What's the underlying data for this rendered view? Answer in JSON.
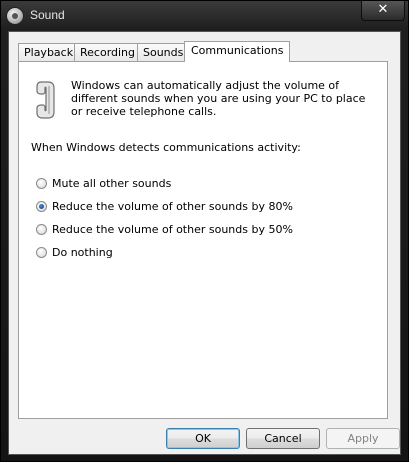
{
  "window": {
    "title": "Sound",
    "close_label": "✕"
  },
  "tabs": [
    {
      "label": "Playback"
    },
    {
      "label": "Recording"
    },
    {
      "label": "Sounds"
    },
    {
      "label": "Communications",
      "active": true
    }
  ],
  "communications": {
    "description": "Windows can automatically adjust the volume of different sounds when you are using your PC to place or receive telephone calls.",
    "prompt": "When Windows detects communications activity:",
    "options": [
      {
        "label": "Mute all other sounds",
        "checked": false
      },
      {
        "label": "Reduce the volume of other sounds by 80%",
        "checked": true
      },
      {
        "label": "Reduce the volume of other sounds by 50%",
        "checked": false
      },
      {
        "label": "Do nothing",
        "checked": false
      }
    ]
  },
  "buttons": {
    "ok": "OK",
    "cancel": "Cancel",
    "apply": "Apply"
  },
  "icons": {
    "app": "speaker-icon",
    "phone": "telephone-handset-icon"
  }
}
